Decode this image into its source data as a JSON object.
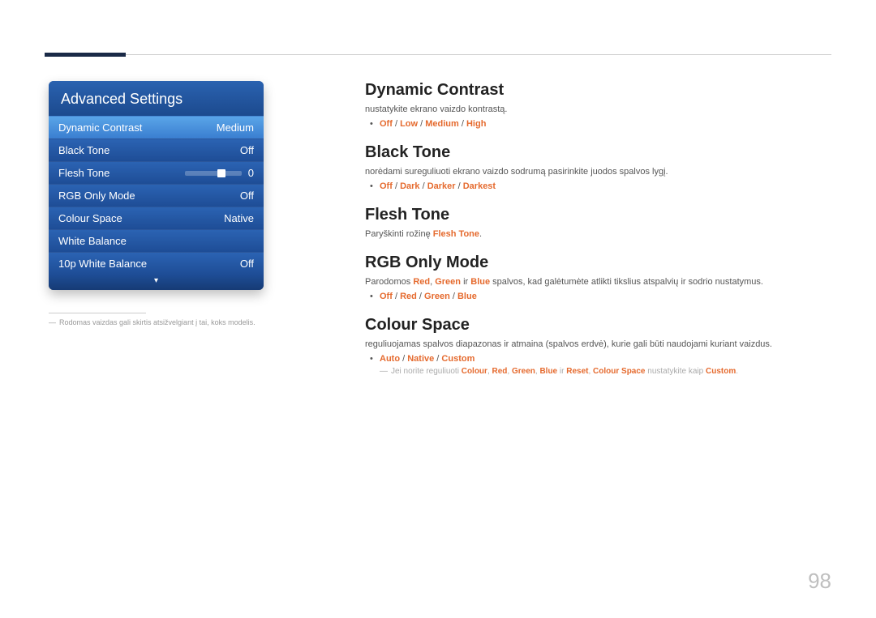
{
  "page_number": "98",
  "menu": {
    "title": "Advanced Settings",
    "items": [
      {
        "label": "Dynamic Contrast",
        "value": "Medium",
        "highlight": true
      },
      {
        "label": "Black Tone",
        "value": "Off"
      },
      {
        "label": "Flesh Tone",
        "value": "0",
        "slider": true
      },
      {
        "label": "RGB Only Mode",
        "value": "Off"
      },
      {
        "label": "Colour Space",
        "value": "Native"
      },
      {
        "label": "White Balance",
        "value": ""
      },
      {
        "label": "10p White Balance",
        "value": "Off"
      }
    ],
    "arrow": "▾"
  },
  "left_footnote": {
    "dash": "―",
    "text": "Rodomas vaizdas gali skirtis atsižvelgiant į tai, koks modelis."
  },
  "sections": {
    "dynamic_contrast": {
      "title": "Dynamic Contrast",
      "desc": "nustatykite ekrano vaizdo kontrastą.",
      "options": [
        "Off",
        "Low",
        "Medium",
        "High"
      ]
    },
    "black_tone": {
      "title": "Black Tone",
      "desc": "norėdami sureguliuoti ekrano vaizdo sodrumą pasirinkite juodos spalvos lygį.",
      "options": [
        "Off",
        "Dark",
        "Darker",
        "Darkest"
      ]
    },
    "flesh_tone": {
      "title": "Flesh Tone",
      "desc_pre": "Paryškinti rožinę ",
      "desc_term": "Flesh Tone",
      "desc_post": "."
    },
    "rgb_only": {
      "title": "RGB Only Mode",
      "desc_pre": "Parodomos ",
      "t_red": "Red",
      "c1": ", ",
      "t_green": "Green",
      "c2": " ir ",
      "t_blue": "Blue",
      "desc_post": " spalvos, kad galėtumėte atlikti tikslius atspalvių ir sodrio nustatymus.",
      "options": [
        "Off",
        "Red",
        "Green",
        "Blue"
      ]
    },
    "colour_space": {
      "title": "Colour Space",
      "desc": "reguliuojamas spalvos diapazonas ir atmaina (spalvos erdvė), kurie gali būti naudojami kuriant vaizdus.",
      "options": [
        "Auto",
        "Native",
        "Custom"
      ],
      "note_dash": "―",
      "note_pre": "Jei norite reguliuoti ",
      "n_colour": "Colour",
      "nc1": ", ",
      "n_red": "Red",
      "nc2": ", ",
      "n_green": "Green",
      "nc3": ", ",
      "n_blue": "Blue",
      "nc4": " ir ",
      "n_reset": "Reset",
      "nc5": ", ",
      "n_cs": "Colour Space",
      "note_mid": " nustatykite kaip ",
      "n_custom": "Custom",
      "note_post": "."
    }
  },
  "sep": " / "
}
